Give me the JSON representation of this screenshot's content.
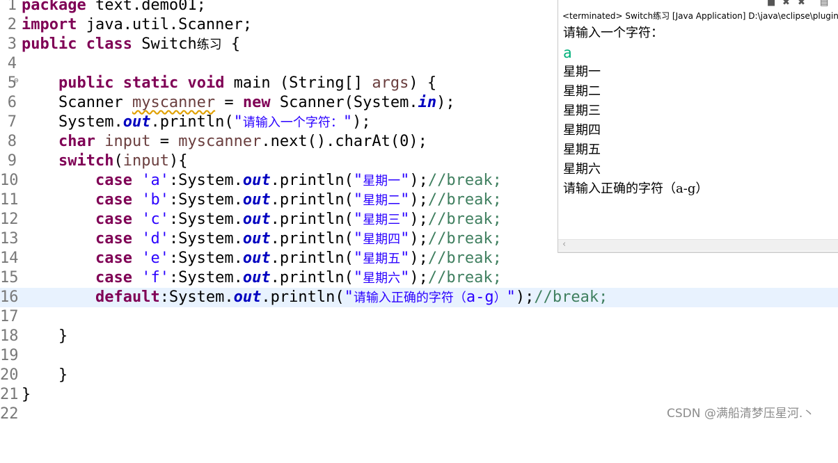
{
  "editor": {
    "line_numbers": [
      "1",
      "2",
      "3",
      "4",
      "5",
      "6",
      "7",
      "8",
      "9",
      "10",
      "11",
      "12",
      "13",
      "14",
      "15",
      "16",
      "17",
      "18",
      "19",
      "20",
      "21",
      "22"
    ],
    "fold_marker": "⊖",
    "l1": {
      "kw": "package",
      "rest": " text.demo01;"
    },
    "l2": {
      "kw": "import",
      "rest": " java.util.Scanner;"
    },
    "l3": {
      "kw1": "public",
      "kw2": "class",
      "name": " Switch",
      "name_cn": "练习",
      "brace": " {"
    },
    "l5": {
      "kw1": "public",
      "kw2": "static",
      "kw3": "void",
      "mid": " main (String[] ",
      "args": "args",
      "tail": ") {"
    },
    "l6": {
      "lead": "Scanner ",
      "var": "myscanner",
      "eq": " = ",
      "kw": "new",
      "mid": " Scanner(System.",
      "fld": "in",
      "tail": ");"
    },
    "l7": {
      "lead": "System.",
      "fld": "out",
      "mid": ".println(",
      "q1": "\"",
      "cn": "请输入一个字符：",
      "q2": "\"",
      "tail": ");"
    },
    "l8": {
      "kw": "char",
      "sp": " ",
      "var": "input",
      "mid": " = ",
      "var2": "myscanner",
      "tail": ".next().charAt(0);"
    },
    "l9": {
      "kw": "switch",
      "open": "(",
      "var": "input",
      "tail": "){"
    },
    "cases": [
      {
        "kw": "case",
        "ch": " 'a'",
        "mid": ":System.",
        "fld": "out",
        "println": ".println(",
        "q1": "\"",
        "cn": "星期一",
        "q2": "\"",
        "close": ");",
        "cmt": "//break;"
      },
      {
        "kw": "case",
        "ch": " 'b'",
        "mid": ":System.",
        "fld": "out",
        "println": ".println(",
        "q1": "\"",
        "cn": "星期二",
        "q2": "\"",
        "close": ");",
        "cmt": "//break;"
      },
      {
        "kw": "case",
        "ch": " 'c'",
        "mid": ":System.",
        "fld": "out",
        "println": ".println(",
        "q1": "\"",
        "cn": "星期三",
        "q2": "\"",
        "close": ");",
        "cmt": "//break;"
      },
      {
        "kw": "case",
        "ch": " 'd'",
        "mid": ":System.",
        "fld": "out",
        "println": ".println(",
        "q1": "\"",
        "cn": "星期四",
        "q2": "\"",
        "close": ");",
        "cmt": "//break;"
      },
      {
        "kw": "case",
        "ch": " 'e'",
        "mid": ":System.",
        "fld": "out",
        "println": ".println(",
        "q1": "\"",
        "cn": "星期五",
        "q2": "\"",
        "close": ");",
        "cmt": "//break;"
      },
      {
        "kw": "case",
        "ch": " 'f'",
        "mid": ":System.",
        "fld": "out",
        "println": ".println(",
        "q1": "\"",
        "cn": "星期六",
        "q2": "\"",
        "close": ");",
        "cmt": "//break;"
      }
    ],
    "l16": {
      "kw": "default",
      "mid": ":System.",
      "fld": "out",
      "println": ".println(",
      "q1": "\"",
      "cn": "请输入正确的字符（",
      "str_tail": "a-g",
      "cn2": "）",
      "q2": "\"",
      "close": ");",
      "cmt": "//break;"
    },
    "l18": {
      "text": "}"
    },
    "l20": {
      "text": "}"
    },
    "l21": {
      "text": "}"
    }
  },
  "console": {
    "toolbar_icons": [
      "terminate-icon",
      "remove-launch-icon",
      "remove-all-icon",
      "pin-console-icon"
    ],
    "icon_glyphs": {
      "terminate": "■",
      "remove": "✖",
      "remove_all": "✖",
      "pin": "▤"
    },
    "header": "<terminated> Switch练习 [Java Application] D:\\java\\eclipse\\plugins\\org",
    "lines": [
      {
        "text": "请输入一个字符：",
        "kind": "output"
      },
      {
        "text": "a",
        "kind": "input"
      },
      {
        "text": "星期一",
        "kind": "output"
      },
      {
        "text": "星期二",
        "kind": "output"
      },
      {
        "text": "星期三",
        "kind": "output"
      },
      {
        "text": "星期四",
        "kind": "output"
      },
      {
        "text": "星期五",
        "kind": "output"
      },
      {
        "text": "星期六",
        "kind": "output"
      },
      {
        "text": "请输入正确的字符（a-g）",
        "kind": "output"
      }
    ],
    "scroll_left_glyph": "‹",
    "input_color": "#00b07a"
  },
  "watermark": "CSDN @满船清梦压星河.丶",
  "colors": {
    "keyword": "#7f0055",
    "string": "#2a00ff",
    "field": "#0000c0",
    "comment": "#3f7f5f",
    "current_line": "#e8f2fe"
  }
}
